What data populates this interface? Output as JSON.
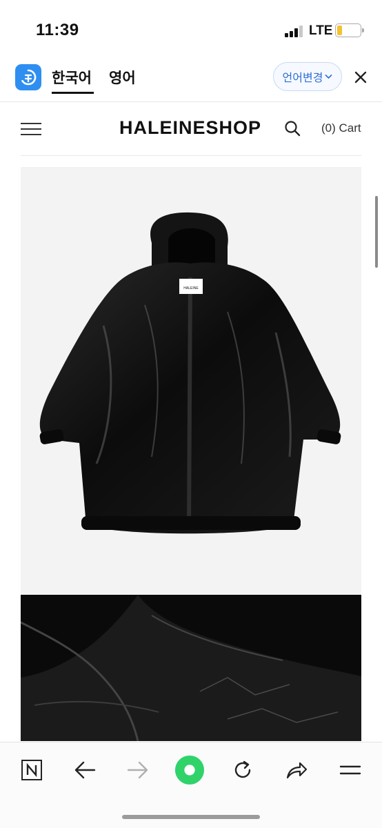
{
  "status_bar": {
    "time": "11:39",
    "network": "LTE",
    "battery_level": 0.22
  },
  "translate_bar": {
    "logo_icon": "papago-translate-icon",
    "languages": [
      "한국어",
      "영어"
    ],
    "selected_language": "한국어",
    "change_language_label": "언어변경",
    "accent_color": "#2f8ff0"
  },
  "header": {
    "brand": "HALEINESHOP",
    "cart_label": "(0) Cart"
  },
  "product": {
    "main_image": "black-leather-hooded-jacket",
    "label_tag": "HALEINE",
    "detail_image": "leather-texture-closeup"
  },
  "toolbar": {
    "icons": [
      "naver-n-icon",
      "back-arrow-icon",
      "forward-arrow-icon",
      "green-home-circle-icon",
      "refresh-icon",
      "share-icon",
      "menu-icon"
    ],
    "home_color": "#2fd36a"
  }
}
